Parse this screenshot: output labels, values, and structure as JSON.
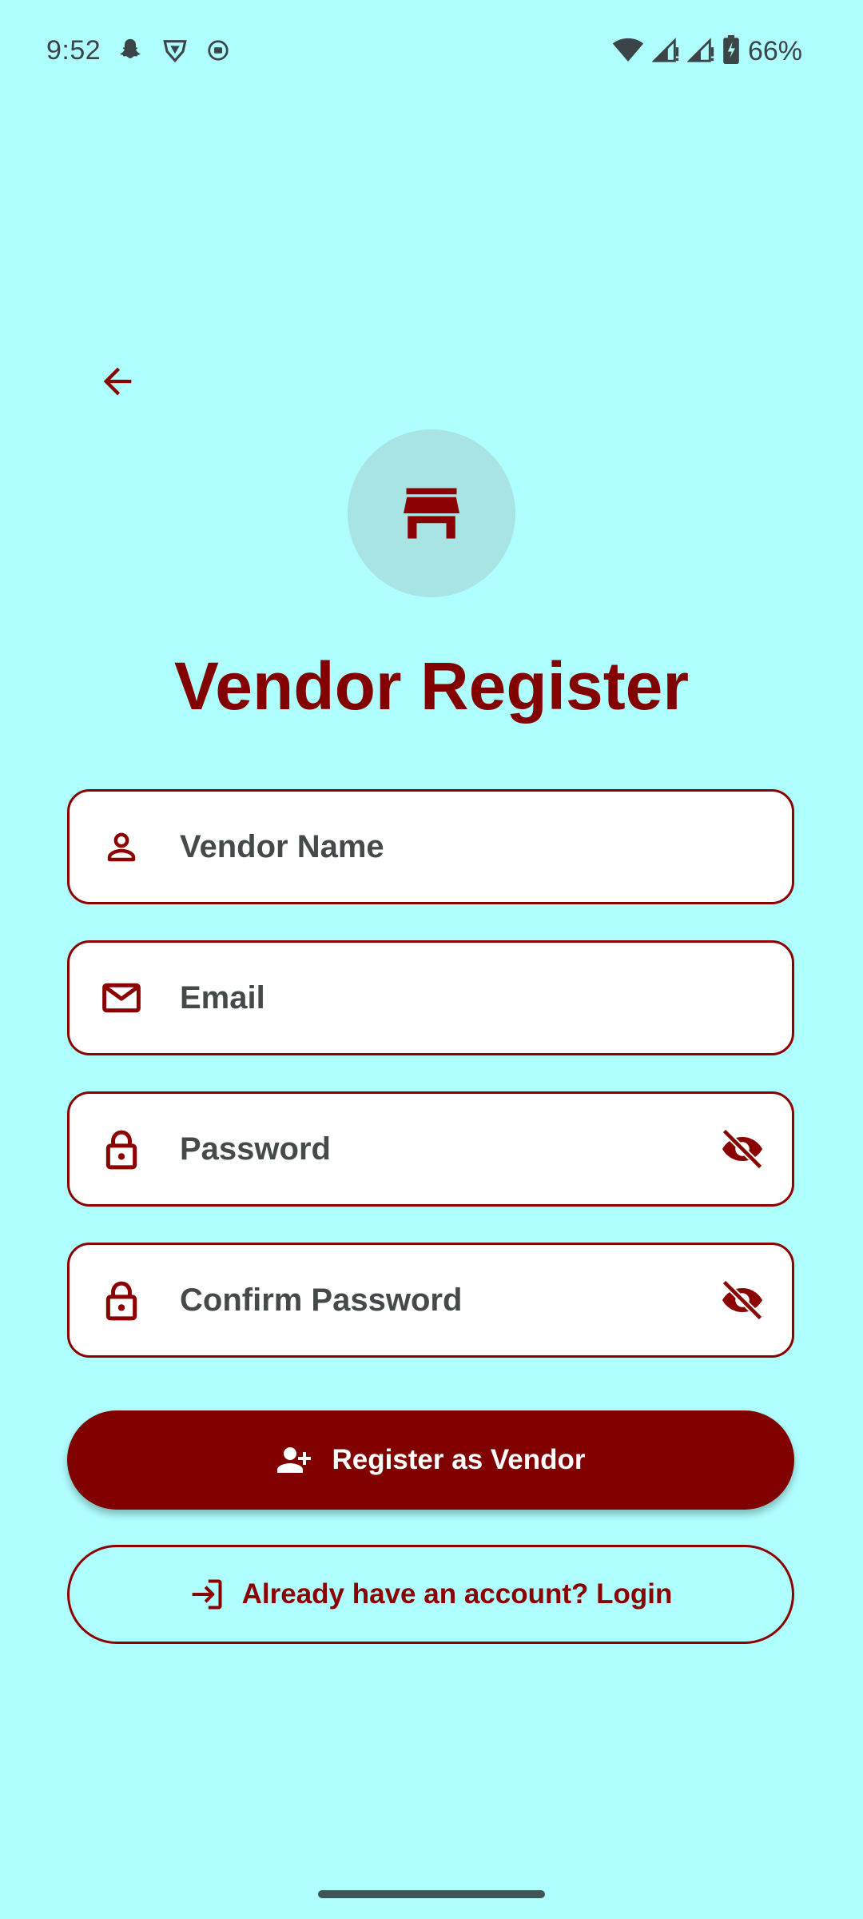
{
  "status_bar": {
    "time": "9:52",
    "battery": "66%",
    "left_icons": [
      "snapchat-icon",
      "vpn-shield-icon",
      "screen-record-icon"
    ],
    "right_icons": [
      "wifi-icon",
      "signal-icon",
      "signal-icon",
      "battery-icon"
    ]
  },
  "header": {
    "back_icon": "arrow-back-icon",
    "avatar_icon": "store-icon",
    "title": "Vendor Register"
  },
  "form": {
    "vendor_name": {
      "placeholder": "Vendor Name",
      "value": "",
      "icon": "person-icon"
    },
    "email": {
      "placeholder": "Email",
      "value": "",
      "icon": "mail-icon"
    },
    "password": {
      "placeholder": "Password",
      "value": "",
      "icon": "lock-icon",
      "toggle_icon": "eye-off-icon"
    },
    "confirm_password": {
      "placeholder": "Confirm Password",
      "value": "",
      "icon": "lock-icon",
      "toggle_icon": "eye-off-icon"
    }
  },
  "actions": {
    "register_label": "Register as Vendor",
    "register_icon": "person-add-icon",
    "login_label": "Already have an account? Login",
    "login_icon": "login-icon"
  },
  "colors": {
    "background": "#b0ffff",
    "primary": "#800000",
    "avatar_bg": "#a9e4e4",
    "field_bg": "#ffffff"
  }
}
